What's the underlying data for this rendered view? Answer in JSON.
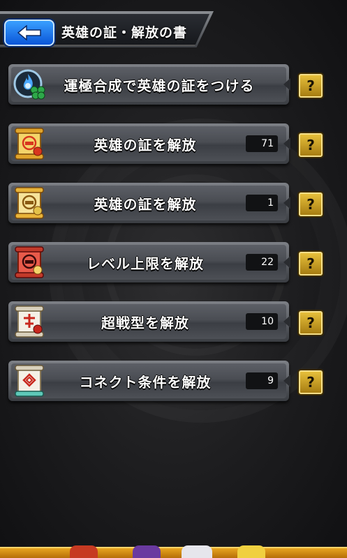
{
  "header": {
    "title": "英雄の証・解放の書",
    "back_icon": "back-arrow-icon"
  },
  "rows": [
    {
      "label": "運極合成で英雄の証をつける",
      "count": "",
      "icon": "flame-clover-icon"
    },
    {
      "label": "英雄の証を解放",
      "count": "71",
      "icon": "scroll-red-seal-icon"
    },
    {
      "label": "英雄の証を解放",
      "count": "1",
      "icon": "scroll-gold-seal-icon"
    },
    {
      "label": "レベル上限を解放",
      "count": "22",
      "icon": "scroll-red-icon"
    },
    {
      "label": "超戦型を解放",
      "count": "10",
      "icon": "scroll-white-icon"
    },
    {
      "label": "コネクト条件を解放",
      "count": "9",
      "icon": "scroll-teal-icon"
    }
  ],
  "help_label": "?",
  "colors": {
    "help_button": "#d4a82a",
    "back_button": "#1f7cf0",
    "row_bg": "#4a4d53"
  }
}
